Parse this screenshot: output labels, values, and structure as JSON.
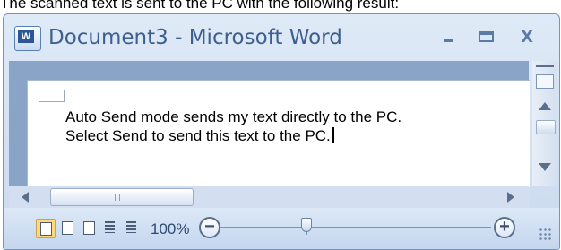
{
  "caption": "The scanned text is sent to the PC with the following result:",
  "window": {
    "title": "Document3 - Microsoft Word",
    "icon": "word-app-icon",
    "close_glyph": "x"
  },
  "document": {
    "lines": [
      "Auto Send mode sends my text directly to the PC.",
      "Select Send to send this text to the PC."
    ]
  },
  "statusbar": {
    "zoom_level": "100%",
    "zoom_out_glyph": "−",
    "zoom_in_glyph": "+",
    "views": [
      "print-layout",
      "full-screen-reading",
      "web-layout",
      "outline",
      "draft"
    ],
    "active_view": "print-layout",
    "zoom_slider_fraction": 0.5
  },
  "colors": {
    "title_text": "#3e5f8e",
    "frame": "#c9d9ee",
    "active_view": "#ffd87a"
  }
}
